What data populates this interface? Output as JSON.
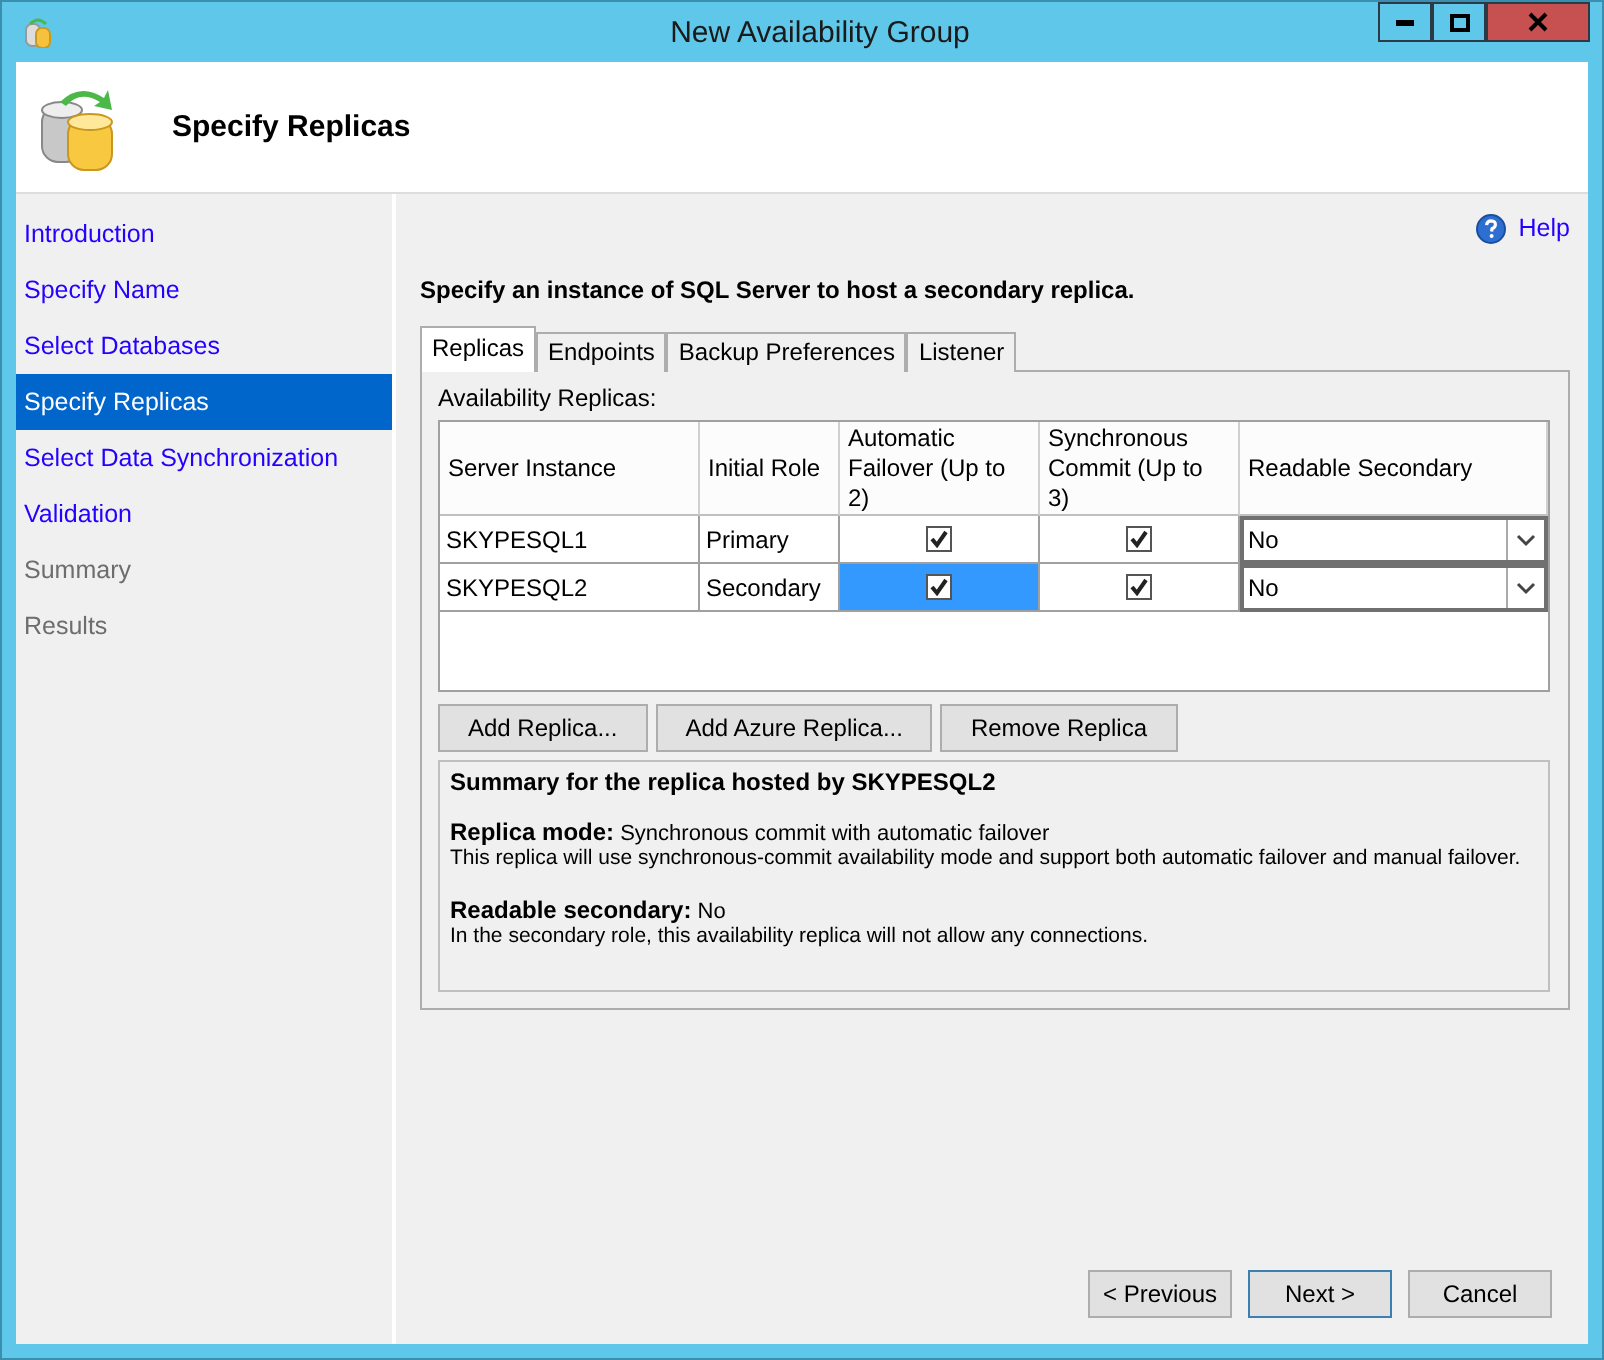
{
  "window": {
    "title": "New Availability Group"
  },
  "header": {
    "title": "Specify Replicas"
  },
  "nav": [
    {
      "label": "Introduction",
      "selected": false,
      "disabled": false
    },
    {
      "label": "Specify Name",
      "selected": false,
      "disabled": false
    },
    {
      "label": "Select Databases",
      "selected": false,
      "disabled": false
    },
    {
      "label": "Specify Replicas",
      "selected": true,
      "disabled": false
    },
    {
      "label": "Select Data Synchronization",
      "selected": false,
      "disabled": false
    },
    {
      "label": "Validation",
      "selected": false,
      "disabled": false
    },
    {
      "label": "Summary",
      "selected": false,
      "disabled": true
    },
    {
      "label": "Results",
      "selected": false,
      "disabled": true
    }
  ],
  "help": "Help",
  "instruction": "Specify an instance of SQL Server to host a secondary replica.",
  "tabs": [
    {
      "label": "Replicas",
      "selected": true
    },
    {
      "label": "Endpoints",
      "selected": false
    },
    {
      "label": "Backup Preferences",
      "selected": false
    },
    {
      "label": "Listener",
      "selected": false
    }
  ],
  "replicas_label": "Availability Replicas:",
  "table": {
    "columns": [
      "Server Instance",
      "Initial Role",
      "Automatic Failover (Up to 2)",
      "Synchronous Commit (Up to 3)",
      "Readable Secondary"
    ],
    "rows": [
      {
        "server": "SKYPESQL1",
        "role": "Primary",
        "automatic_failover": true,
        "failover_selected": false,
        "synchronous_commit": true,
        "readable": "No"
      },
      {
        "server": "SKYPESQL2",
        "role": "Secondary",
        "automatic_failover": true,
        "failover_selected": true,
        "synchronous_commit": true,
        "readable": "No"
      }
    ]
  },
  "actions": [
    "Add Replica...",
    "Add Azure Replica...",
    "Remove Replica"
  ],
  "summary": {
    "title": "Summary for the replica hosted by SKYPESQL2",
    "sections": [
      {
        "label": "Replica mode:",
        "value": "Synchronous commit with automatic failover",
        "description": "This replica will use synchronous-commit availability mode and support both automatic failover and manual failover."
      },
      {
        "label": "Readable secondary:",
        "value": "No",
        "description": "In the secondary role, this availability replica will not allow any connections."
      }
    ]
  },
  "footer": [
    {
      "label": "< Previous",
      "default": false
    },
    {
      "label": "Next >",
      "default": true
    },
    {
      "label": "Cancel",
      "default": false
    }
  ]
}
